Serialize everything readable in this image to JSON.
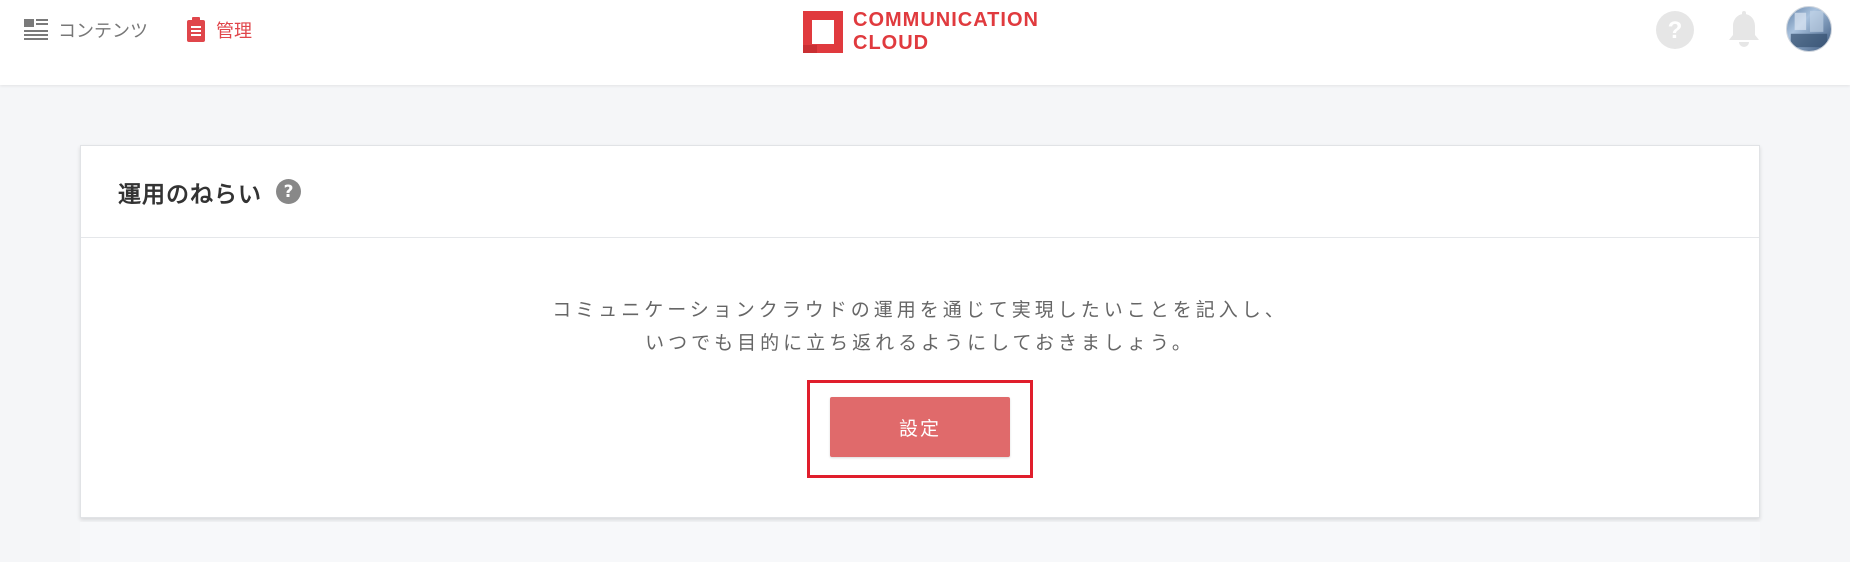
{
  "nav": {
    "contents_label": "コンテンツ",
    "contents_icon": "list-icon",
    "admin_label": "管理",
    "admin_icon": "clipboard-icon"
  },
  "logo": {
    "line1": "COMMUNICATION",
    "line2": "CLOUD"
  },
  "header_actions": {
    "help_icon": "help-icon",
    "bell_icon": "bell-icon",
    "avatar": "avatar"
  },
  "card": {
    "title": "運用のねらい",
    "help_glyph": "?",
    "description_line1": "コミュニケーションクラウドの運用を通じて実現したいことを記入し、",
    "description_line2": "いつでも目的に立ち返れるようにしておきましょう。",
    "button_label": "設定"
  },
  "colors": {
    "brand_red": "#e03a3e",
    "button_red": "#e06a6b",
    "highlight_frame": "#e01e2c",
    "background": "#f5f6f8"
  }
}
